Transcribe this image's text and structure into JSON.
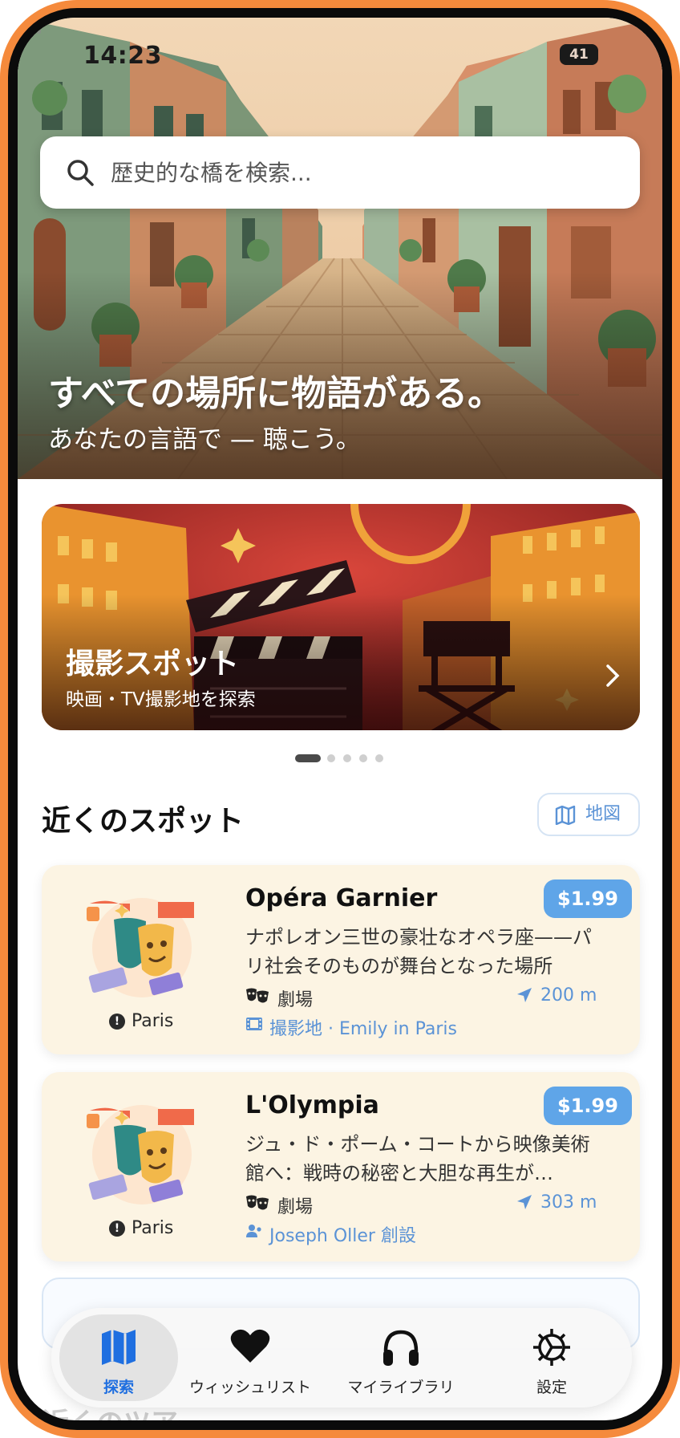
{
  "status": {
    "time": "14:23",
    "battery": "41"
  },
  "search": {
    "placeholder": "歴史的な橋を検索..."
  },
  "hero": {
    "title": "すべての場所に物語がある。",
    "subtitle": "あなたの言語で — 聴こう。"
  },
  "banner": {
    "title": "撮影スポット",
    "subtitle": "映画・TV撮影地を探索",
    "page_count": 5,
    "active_page": 1
  },
  "nearby": {
    "title": "近くのスポット",
    "map_label": "地図",
    "cards": [
      {
        "name": "Opéra Garnier",
        "price": "$1.99",
        "description": "ナポレオン三世の豪壮なオペラ座——パリ社会そのものが舞台となった場所",
        "category": "劇場",
        "distance": "200 m",
        "tag": "撮影地 · Emily in Paris",
        "tag_icon": "film-icon",
        "city": "Paris"
      },
      {
        "name": "L'Olympia",
        "price": "$1.99",
        "description": "ジュ・ド・ポーム・コートから映像美術館へ：戦時の秘密と大胆な再生が…",
        "category": "劇場",
        "distance": "303 m",
        "tag": "Joseph Oller 創設",
        "tag_icon": "person-icon",
        "city": "Paris"
      }
    ]
  },
  "next_section": {
    "title": "近くのツアー"
  },
  "tabs": [
    {
      "label": "探索",
      "icon": "map-icon",
      "active": true
    },
    {
      "label": "ウィッシュリスト",
      "icon": "heart-icon",
      "active": false
    },
    {
      "label": "マイライブラリ",
      "icon": "headphones-icon",
      "active": false
    },
    {
      "label": "設定",
      "icon": "gear-icon",
      "active": false
    }
  ],
  "colors": {
    "frame": "#f58a3c",
    "accent": "#5fa5e8",
    "card_bg": "#fcf4e3",
    "tab_active": "#1f6fe0"
  }
}
